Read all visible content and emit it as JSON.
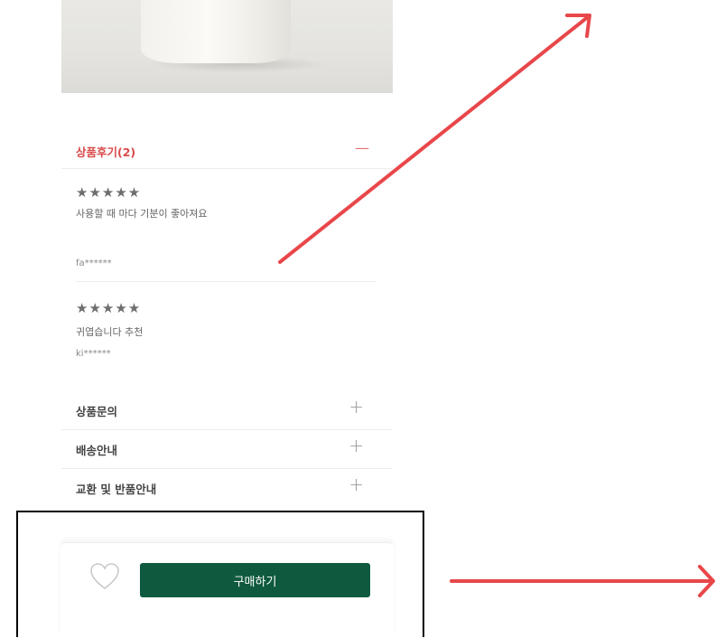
{
  "reviews": {
    "title": "상품후기(2)",
    "toggle_glyph": "—",
    "items": [
      {
        "stars": "★★★★★",
        "text": "사용할 때 마다 기분이 좋아져요",
        "author": "fa******"
      },
      {
        "stars": "★★★★★",
        "text": "귀엽습니다 추천",
        "author": "ki******"
      }
    ]
  },
  "sections": [
    {
      "label": "상품문의",
      "icon": "+"
    },
    {
      "label": "배송안내",
      "icon": "+"
    },
    {
      "label": "교환 및 반품안내",
      "icon": "+"
    }
  ],
  "purchase": {
    "buy_label": "구매하기",
    "wishlist_icon": "heart-outline-icon",
    "buy_color": "#0f5a3e"
  },
  "colors": {
    "accent": "#d94a4a",
    "annotation_arrow": "#e8474a"
  }
}
